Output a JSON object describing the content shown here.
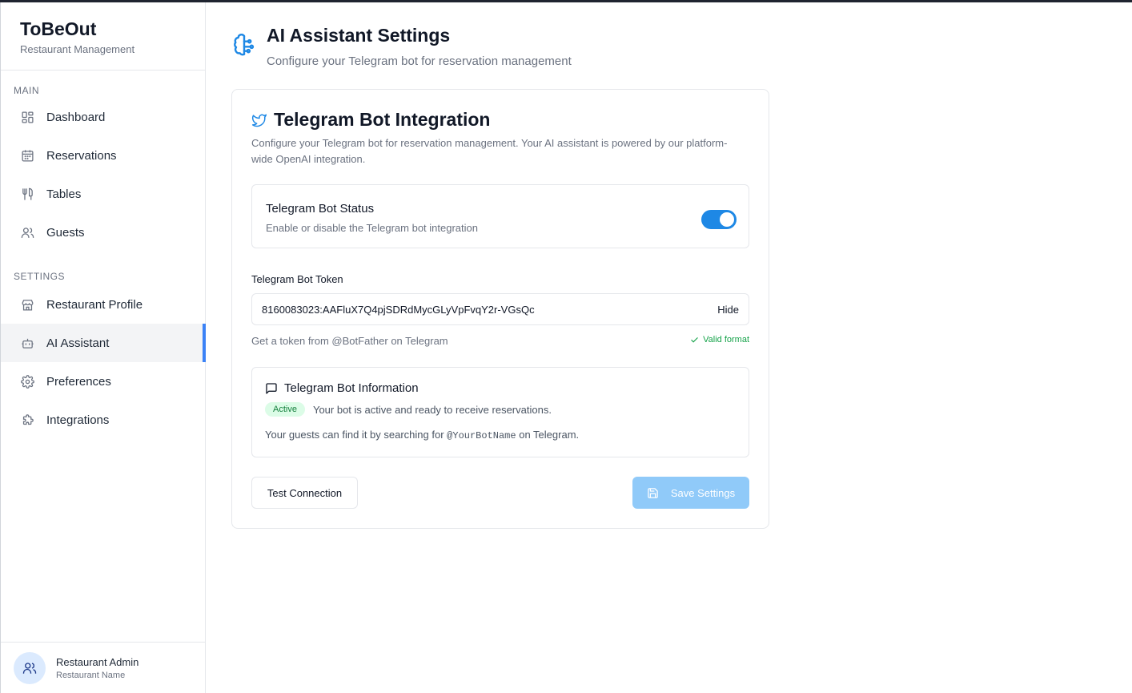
{
  "app": {
    "name": "ToBeOut",
    "subtitle": "Restaurant Management"
  },
  "sidebar": {
    "main_label": "MAIN",
    "main_items": [
      {
        "label": "Dashboard",
        "icon": "grid-icon"
      },
      {
        "label": "Reservations",
        "icon": "calendar-icon"
      },
      {
        "label": "Tables",
        "icon": "utensils-icon"
      },
      {
        "label": "Guests",
        "icon": "users-icon"
      }
    ],
    "settings_label": "SETTINGS",
    "settings_items": [
      {
        "label": "Restaurant Profile",
        "icon": "store-icon"
      },
      {
        "label": "AI Assistant",
        "icon": "bot-icon",
        "active": true
      },
      {
        "label": "Preferences",
        "icon": "gear-icon"
      },
      {
        "label": "Integrations",
        "icon": "puzzle-icon"
      }
    ],
    "user": {
      "name": "Restaurant Admin",
      "sub": "Restaurant Name"
    }
  },
  "page": {
    "title": "AI Assistant Settings",
    "subtitle": "Configure your Telegram bot for reservation management",
    "icon": "brain-icon"
  },
  "card": {
    "title": "Telegram Bot Integration",
    "description": "Configure your Telegram bot for reservation management. Your AI assistant is powered by our platform-wide OpenAI integration.",
    "status": {
      "title": "Telegram Bot Status",
      "description": "Enable or disable the Telegram bot integration",
      "enabled": true
    },
    "token": {
      "label": "Telegram Bot Token",
      "value": "8160083023:AAFluX7Q4pjSDRdMycGLyVpFvqY2r-VGsQc",
      "toggle_label": "Hide",
      "help": "Get a token from @BotFather on Telegram",
      "valid_text": "Valid format"
    },
    "info": {
      "title": "Telegram Bot Information",
      "badge": "Active",
      "status_text": "Your bot is active and ready to receive reservations.",
      "search_prefix": "Your guests can find it by searching for",
      "bot_name": "@YourBotName",
      "search_suffix": "on Telegram."
    },
    "buttons": {
      "test": "Test Connection",
      "save": "Save Settings"
    }
  },
  "colors": {
    "accent": "#3b82f6",
    "toggle_on": "#1e88e5",
    "save_disabled": "#90caf9",
    "valid_green": "#16a34a"
  }
}
